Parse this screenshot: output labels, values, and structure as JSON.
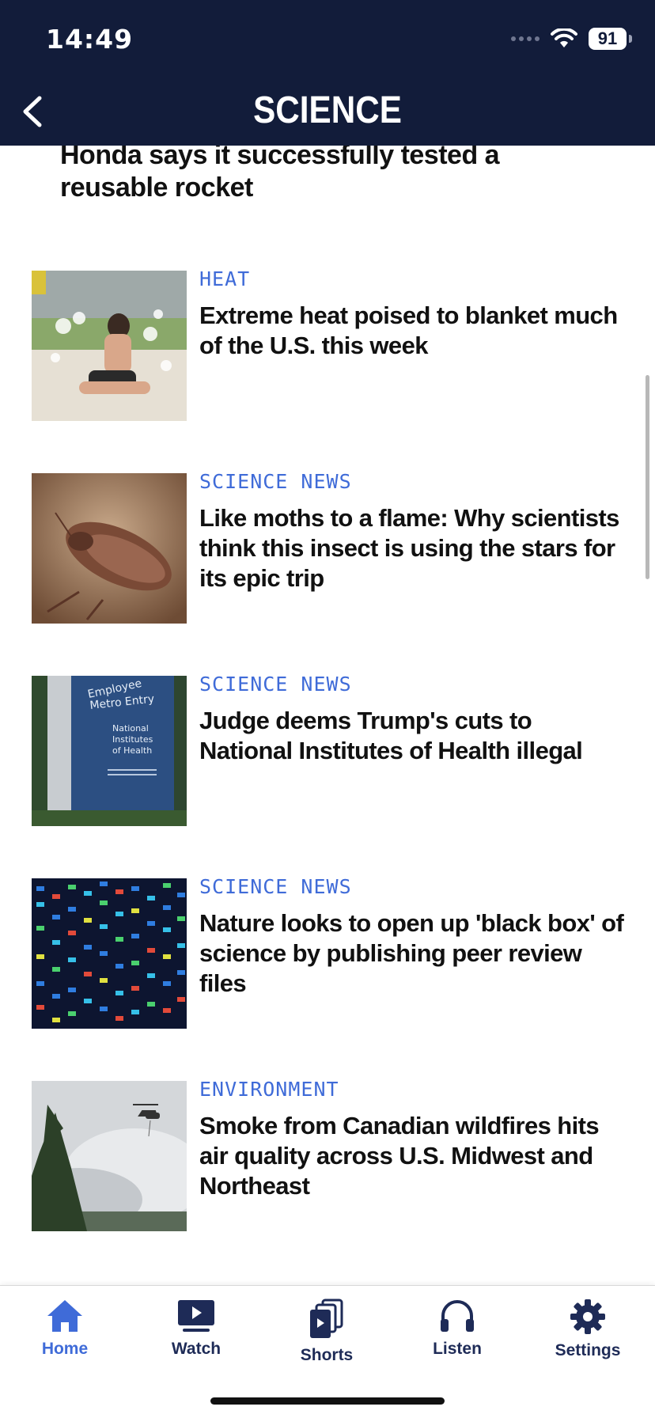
{
  "status": {
    "time": "14:49",
    "battery": "91"
  },
  "header": {
    "title": "SCIENCE",
    "back_icon": "chevron-left-icon"
  },
  "lead_article": {
    "headline": "Honda says it successfully tested a reusable rocket"
  },
  "articles": [
    {
      "kicker": "HEAT",
      "headline": "Extreme heat poised to blanket much of the U.S. this week"
    },
    {
      "kicker": "SCIENCE NEWS",
      "headline": "Like moths to a flame: Why scientists think this insect is using the stars for its epic trip"
    },
    {
      "kicker": "SCIENCE NEWS",
      "headline": "Judge deems Trump's cuts to National Institutes of Health illegal",
      "image_sign": [
        "Employee",
        "Metro Entry",
        "National",
        "Institutes",
        "of Health"
      ]
    },
    {
      "kicker": "SCIENCE NEWS",
      "headline": "Nature looks to open up 'black box' of science by publishing peer review files"
    },
    {
      "kicker": "ENVIRONMENT",
      "headline": "Smoke from Canadian wildfires hits air quality across U.S. Midwest and Northeast"
    }
  ],
  "tabs": [
    {
      "label": "Home",
      "icon": "home-icon",
      "active": true
    },
    {
      "label": "Watch",
      "icon": "play-screen-icon",
      "active": false
    },
    {
      "label": "Shorts",
      "icon": "shorts-stack-icon",
      "active": false
    },
    {
      "label": "Listen",
      "icon": "headphones-icon",
      "active": false
    },
    {
      "label": "Settings",
      "icon": "gear-icon",
      "active": false
    }
  ],
  "colors": {
    "header_bg": "#121c3a",
    "kicker": "#3f6bd8",
    "tab_active": "#3f6bd8",
    "tab_inactive": "#1e2b57"
  }
}
